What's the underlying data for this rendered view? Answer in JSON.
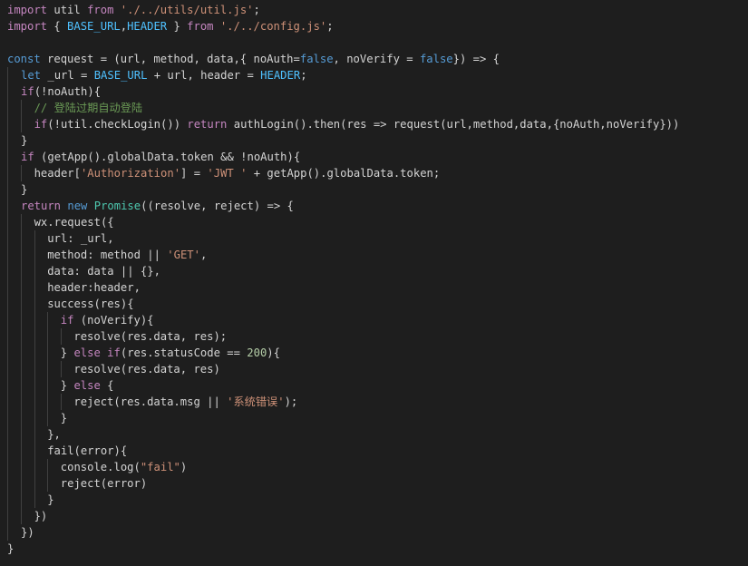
{
  "colors": {
    "background": "#1e1e1e",
    "plain": "#d4d4d4",
    "keyword": "#569cd6",
    "control": "#c586c0",
    "string": "#ce9178",
    "number": "#b5cea8",
    "comment": "#6a9955",
    "const": "#4fc1ff",
    "func": "#dcdcaa",
    "type": "#4ec9b0",
    "indent_guide": "#404040"
  },
  "editor": {
    "lines": [
      {
        "indent": 0,
        "tokens": [
          [
            "control",
            "import"
          ],
          [
            "plain",
            " util "
          ],
          [
            "control",
            "from"
          ],
          [
            "plain",
            " "
          ],
          [
            "string",
            "'./../utils/util.js'"
          ],
          [
            "plain",
            ";"
          ]
        ]
      },
      {
        "indent": 0,
        "tokens": [
          [
            "control",
            "import"
          ],
          [
            "plain",
            " { "
          ],
          [
            "const",
            "BASE_URL"
          ],
          [
            "plain",
            ","
          ],
          [
            "const",
            "HEADER"
          ],
          [
            "plain",
            " } "
          ],
          [
            "control",
            "from"
          ],
          [
            "plain",
            " "
          ],
          [
            "string",
            "'./../config.js'"
          ],
          [
            "plain",
            ";"
          ]
        ]
      },
      {
        "indent": 0,
        "tokens": []
      },
      {
        "indent": 0,
        "tokens": [
          [
            "keyword",
            "const"
          ],
          [
            "plain",
            " request = (url, method, data,{ noAuth="
          ],
          [
            "keyword",
            "false"
          ],
          [
            "plain",
            ", noVerify = "
          ],
          [
            "keyword",
            "false"
          ],
          [
            "plain",
            "}) => {"
          ]
        ]
      },
      {
        "indent": 1,
        "tokens": [
          [
            "keyword",
            "let"
          ],
          [
            "plain",
            " _url = "
          ],
          [
            "const",
            "BASE_URL"
          ],
          [
            "plain",
            " + url, header = "
          ],
          [
            "const",
            "HEADER"
          ],
          [
            "plain",
            ";"
          ]
        ]
      },
      {
        "indent": 1,
        "tokens": [
          [
            "control",
            "if"
          ],
          [
            "plain",
            "(!noAuth){"
          ]
        ]
      },
      {
        "indent": 2,
        "tokens": [
          [
            "comment",
            "// 登陆过期自动登陆"
          ]
        ]
      },
      {
        "indent": 2,
        "tokens": [
          [
            "control",
            "if"
          ],
          [
            "plain",
            "(!util.checkLogin()) "
          ],
          [
            "control",
            "return"
          ],
          [
            "plain",
            " authLogin().then(res => request(url,method,data,{noAuth,noVerify}))"
          ]
        ]
      },
      {
        "indent": 1,
        "tokens": [
          [
            "plain",
            "}"
          ]
        ]
      },
      {
        "indent": 1,
        "tokens": [
          [
            "control",
            "if"
          ],
          [
            "plain",
            " (getApp().globalData.token && !noAuth){"
          ]
        ]
      },
      {
        "indent": 2,
        "tokens": [
          [
            "plain",
            "header["
          ],
          [
            "string",
            "'Authorization'"
          ],
          [
            "plain",
            "] = "
          ],
          [
            "string",
            "'JWT '"
          ],
          [
            "plain",
            " + getApp().globalData.token;"
          ]
        ]
      },
      {
        "indent": 1,
        "tokens": [
          [
            "plain",
            "}"
          ]
        ]
      },
      {
        "indent": 1,
        "tokens": [
          [
            "control",
            "return"
          ],
          [
            "plain",
            " "
          ],
          [
            "keyword",
            "new"
          ],
          [
            "plain",
            " "
          ],
          [
            "type",
            "Promise"
          ],
          [
            "plain",
            "((resolve, reject) => {"
          ]
        ]
      },
      {
        "indent": 2,
        "tokens": [
          [
            "plain",
            "wx.request({"
          ]
        ]
      },
      {
        "indent": 3,
        "tokens": [
          [
            "plain",
            "url: _url,"
          ]
        ]
      },
      {
        "indent": 3,
        "tokens": [
          [
            "plain",
            "method: method || "
          ],
          [
            "string",
            "'GET'"
          ],
          [
            "plain",
            ","
          ]
        ]
      },
      {
        "indent": 3,
        "tokens": [
          [
            "plain",
            "data: data || {},"
          ]
        ]
      },
      {
        "indent": 3,
        "tokens": [
          [
            "plain",
            "header:header,"
          ]
        ]
      },
      {
        "indent": 3,
        "tokens": [
          [
            "plain",
            "success(res){"
          ]
        ]
      },
      {
        "indent": 4,
        "tokens": [
          [
            "control",
            "if"
          ],
          [
            "plain",
            " (noVerify){"
          ]
        ]
      },
      {
        "indent": 5,
        "tokens": [
          [
            "plain",
            "resolve(res.data, res);"
          ]
        ]
      },
      {
        "indent": 4,
        "tokens": [
          [
            "plain",
            "} "
          ],
          [
            "control",
            "else"
          ],
          [
            "plain",
            " "
          ],
          [
            "control",
            "if"
          ],
          [
            "plain",
            "(res.statusCode == "
          ],
          [
            "number",
            "200"
          ],
          [
            "plain",
            "){"
          ]
        ]
      },
      {
        "indent": 5,
        "tokens": [
          [
            "plain",
            "resolve(res.data, res)"
          ]
        ]
      },
      {
        "indent": 4,
        "tokens": [
          [
            "plain",
            "} "
          ],
          [
            "control",
            "else"
          ],
          [
            "plain",
            " {"
          ]
        ]
      },
      {
        "indent": 5,
        "tokens": [
          [
            "plain",
            "reject(res.data.msg || "
          ],
          [
            "string",
            "'系统错误'"
          ],
          [
            "plain",
            ");"
          ]
        ]
      },
      {
        "indent": 4,
        "tokens": [
          [
            "plain",
            "}"
          ]
        ]
      },
      {
        "indent": 3,
        "tokens": [
          [
            "plain",
            "},"
          ]
        ]
      },
      {
        "indent": 3,
        "tokens": [
          [
            "plain",
            "fail(error){"
          ]
        ]
      },
      {
        "indent": 4,
        "tokens": [
          [
            "plain",
            "console.log("
          ],
          [
            "string",
            "\"fail\""
          ],
          [
            "plain",
            ")"
          ]
        ]
      },
      {
        "indent": 4,
        "tokens": [
          [
            "plain",
            "reject(error)"
          ]
        ]
      },
      {
        "indent": 3,
        "tokens": [
          [
            "plain",
            "}"
          ]
        ]
      },
      {
        "indent": 2,
        "tokens": [
          [
            "plain",
            "})"
          ]
        ]
      },
      {
        "indent": 1,
        "tokens": [
          [
            "plain",
            "})"
          ]
        ]
      },
      {
        "indent": 0,
        "tokens": [
          [
            "plain",
            "}"
          ]
        ]
      }
    ]
  }
}
